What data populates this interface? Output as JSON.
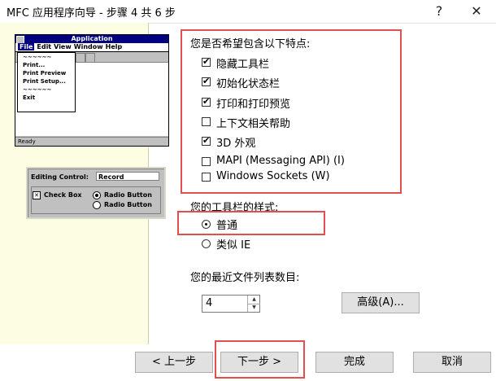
{
  "window": {
    "title": "MFC 应用程序向导 - 步骤 4 共 6 步",
    "help_button": "?",
    "close_button": "✕"
  },
  "illustration": {
    "app_title": "Application",
    "menus": [
      "File",
      "Edit",
      "View",
      "Window",
      "Help"
    ],
    "file_menu_items": [
      "~~~~~~",
      "Print...",
      "Print Preview",
      "Print Setup...",
      "~~~~~~",
      "Exit"
    ],
    "status_text": "Ready",
    "editing_control_label": "Editing Control:",
    "editing_control_value": "Record",
    "check_box_label": "Check Box",
    "radio_button_1": "Radio Button",
    "radio_button_2": "Radio Button"
  },
  "features": {
    "title": "您是否希望包含以下特点:",
    "items": [
      {
        "label": "隐藏工具栏",
        "checked": true
      },
      {
        "label": "初始化状态栏",
        "checked": true
      },
      {
        "label": "打印和打印预览",
        "checked": true
      },
      {
        "label": "上下文相关帮助",
        "checked": false
      },
      {
        "label": "3D 外观",
        "checked": true
      },
      {
        "label": "MAPI  (Messaging API) (I)",
        "checked": false
      },
      {
        "label": "Windows Sockets (W)",
        "checked": false
      }
    ]
  },
  "toolbar_style": {
    "title": "您的工具栏的样式:",
    "options": [
      {
        "label": "普通",
        "selected": true
      },
      {
        "label": "类似 IE",
        "selected": false
      }
    ]
  },
  "mru": {
    "title": "您的最近文件列表数目:",
    "value": "4",
    "advanced_button": "高级(A)..."
  },
  "buttons": {
    "back": "< 上一步",
    "next": "下一步 >",
    "finish": "完成",
    "cancel": "取消"
  },
  "colors": {
    "highlight_border": "#e05050",
    "left_panel_bg": "#fdfde3"
  }
}
